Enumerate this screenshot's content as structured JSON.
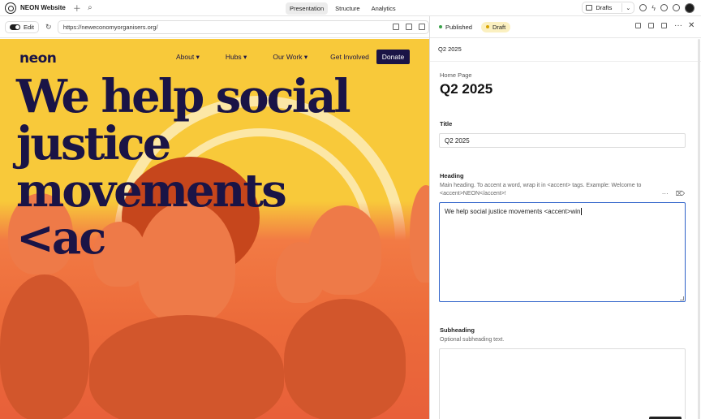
{
  "app": {
    "name": "NEON Website",
    "tabs": [
      {
        "label": "Presentation",
        "active": true
      },
      {
        "label": "Structure",
        "active": false
      },
      {
        "label": "Analytics",
        "active": false
      }
    ],
    "drafts_label": "Drafts"
  },
  "preview_toolbar": {
    "edit_label": "Edit",
    "url": "https://neweconomyorganisers.org/"
  },
  "site": {
    "logo": "neon",
    "nav": [
      {
        "label": "About ▾"
      },
      {
        "label": "Hubs ▾"
      },
      {
        "label": "Our Work ▾"
      },
      {
        "label": "Get Involved"
      }
    ],
    "donate_label": "Donate",
    "hero_lines": [
      "We help social",
      "justice movements",
      "<ac"
    ],
    "colors": {
      "background": "#f8c93a",
      "navy": "#1a1446",
      "orange": "#ec6b3a"
    }
  },
  "panel": {
    "status": {
      "published": "Published",
      "draft": "Draft"
    },
    "doc_id": "Q2 2025",
    "doc_type": "Home Page",
    "doc_title": "Q2 2025",
    "fields": {
      "title": {
        "label": "Title",
        "value": "Q2 2025"
      },
      "heading": {
        "label": "Heading",
        "description": "Main heading. To accent a word, wrap it in <accent> tags. Example: Welcome to <accent>NEON</accent>!",
        "value": "We help social justice movements <accent>win"
      },
      "subheading": {
        "label": "Subheading",
        "description": "Optional subheading text.",
        "value": ""
      }
    }
  }
}
